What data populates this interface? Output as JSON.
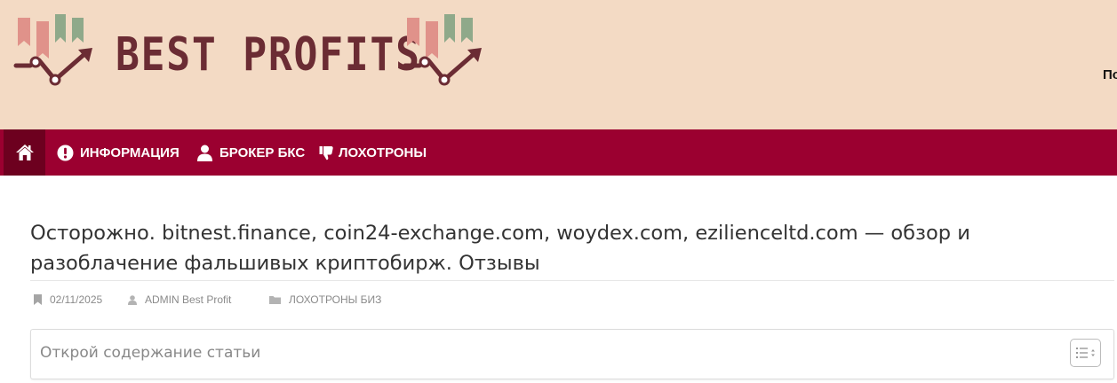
{
  "site": {
    "logo_text": "BEST PROFITS",
    "header_right_text": "По"
  },
  "nav": {
    "home_icon": "home-icon",
    "items": [
      {
        "label": "ИНФОРМАЦИЯ",
        "icon": "exclamation-circle-icon"
      },
      {
        "label": "БРОКЕР БКС",
        "icon": "user-icon"
      },
      {
        "label": "ЛОХОТРОНЫ",
        "icon": "thumbs-down-icon"
      }
    ]
  },
  "article": {
    "title": "Осторожно. bitnest.finance, coin24-exchange.com, woydex.com, ezilienceltd.com — обзор и разоблачение фальшивых криптобирж. Отзывы",
    "date": "02/11/2025",
    "author": "ADMIN Best Profit",
    "category": "ЛОХОТРОНЫ БИЗ"
  },
  "toc": {
    "title": "Открой содержание статьи",
    "toggle_icon": "list-toggle-icon"
  },
  "colors": {
    "header_bg": "#f3dac4",
    "nav_bg": "#9b0030",
    "nav_home_bg": "#6d001f",
    "logo_text": "#6b2c34",
    "logo_bar_pink": "#e0928a",
    "logo_bar_green": "#8fa98a"
  }
}
